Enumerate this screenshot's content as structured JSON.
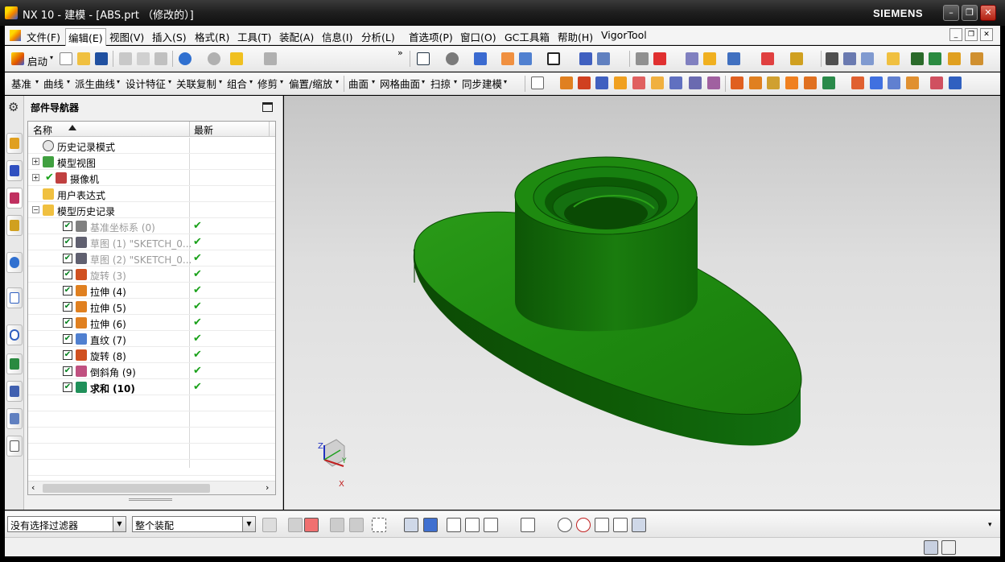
{
  "window": {
    "title": "NX 10 - 建模 - [ABS.prt （修改的）]",
    "brand": "SIEMENS",
    "min_label": "–",
    "max_label": "❐",
    "close_label": "✕"
  },
  "menu": {
    "items": [
      "文件(F)",
      "编辑(E)",
      "视图(V)",
      "插入(S)",
      "格式(R)",
      "工具(T)",
      "装配(A)",
      "信息(I)",
      "分析(L)",
      "首选项(P)",
      "窗口(O)",
      "GC工具箱",
      "帮助(H)",
      "VigorTool"
    ],
    "active_item": "编辑(E)"
  },
  "toolbar1": {
    "start_label": "启动"
  },
  "toolbar2": {
    "dropdowns": [
      "基准",
      "曲线",
      "派生曲线",
      "设计特征",
      "关联复制",
      "组合",
      "修剪",
      "偏置/缩放",
      "曲面",
      "网格曲面",
      "扫掠",
      "同步建模"
    ]
  },
  "navigator": {
    "title": "部件导航器",
    "col_name": "名称",
    "col_latest": "最新",
    "rows": [
      {
        "label": "历史记录模式",
        "icon": "clock-icon",
        "style": "normal"
      },
      {
        "label": "模型视图",
        "icon": "model-views-icon",
        "style": "normal",
        "expander": "+"
      },
      {
        "label": "摄像机",
        "icon": "camera-icon",
        "style": "normal",
        "expander": "+",
        "check": true
      },
      {
        "label": "用户表达式",
        "icon": "folder-icon",
        "style": "normal"
      },
      {
        "label": "模型历史记录",
        "icon": "folder-open-icon",
        "style": "normal",
        "expander": "−"
      },
      {
        "label": "基准坐标系 (0)",
        "icon": "datum-csys-icon",
        "style": "dim",
        "checked": true,
        "latest": "✔"
      },
      {
        "label": "草图 (1) \"SKETCH_0...",
        "icon": "sketch-icon",
        "style": "dim",
        "checked": true,
        "latest": "✔"
      },
      {
        "label": "草图 (2) \"SKETCH_0...",
        "icon": "sketch-icon",
        "style": "dim",
        "checked": true,
        "latest": "✔"
      },
      {
        "label": "旋转 (3)",
        "icon": "revolve-icon",
        "style": "dim",
        "checked": true,
        "latest": "✔"
      },
      {
        "label": "拉伸 (4)",
        "icon": "extrude-icon",
        "style": "normal",
        "checked": true,
        "latest": "✔"
      },
      {
        "label": "拉伸 (5)",
        "icon": "extrude-icon",
        "style": "normal",
        "checked": true,
        "latest": "✔"
      },
      {
        "label": "拉伸 (6)",
        "icon": "extrude-icon",
        "style": "normal",
        "checked": true,
        "latest": "✔"
      },
      {
        "label": "直纹 (7)",
        "icon": "ruled-icon",
        "style": "normal",
        "checked": true,
        "latest": "✔"
      },
      {
        "label": "旋转 (8)",
        "icon": "revolve-icon",
        "style": "normal",
        "checked": true,
        "latest": "✔"
      },
      {
        "label": "倒斜角 (9)",
        "icon": "chamfer-icon",
        "style": "normal",
        "checked": true,
        "latest": "✔"
      },
      {
        "label": "求和 (10)",
        "icon": "unite-icon",
        "style": "bold",
        "checked": true,
        "latest": "✔"
      }
    ]
  },
  "viewport": {
    "triad": {
      "x_label": "X",
      "y_label": "Y",
      "z_label": "Z"
    },
    "colors": {
      "model_face": "#1e8a10",
      "model_side": "#0e5a06"
    }
  },
  "statusbar": {
    "filter_value": "没有选择过滤器",
    "scope_value": "整个装配"
  },
  "colors": {
    "accent": "#1aa11a",
    "brand_bg": "#1e1e1e"
  }
}
